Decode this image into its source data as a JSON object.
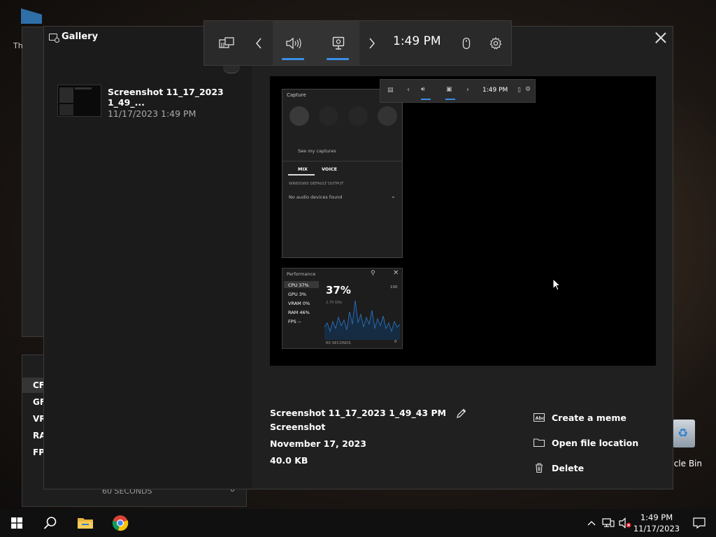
{
  "background": {
    "left_window_fragment": "Th",
    "performance_panel": {
      "labels": [
        "CF",
        "GF",
        "VR",
        "RA",
        "FP"
      ],
      "seconds_label": "60 SECONDS",
      "zero_label": "0"
    },
    "recycle_bin_label": "cycle Bin"
  },
  "game_bar": {
    "time": "1:49 PM",
    "icons": [
      "widget-menu-icon",
      "chevron-left-icon",
      "audio-icon",
      "capture-icon",
      "chevron-right-icon",
      "mouse-icon",
      "gear-icon"
    ],
    "accent_color": "#3a8ee6"
  },
  "gallery": {
    "title": "Gallery",
    "items": [
      {
        "name": "Screenshot 11_17_2023 1_49_...",
        "date": "11/17/2023 1:49 PM"
      }
    ],
    "preview": {
      "capture_title": "Capture",
      "see_my_captures": "See my captures",
      "tab_mix": "MIX",
      "tab_voice": "VOICE",
      "default_output": "WINDOWS DEFAULT OUTPUT",
      "no_devices": "No audio devices found",
      "perf_title": "Performance",
      "perf_stats": [
        "CPU 37%",
        "GPU 3%",
        "VRAM 0%",
        "RAM 46%",
        "FPS --"
      ],
      "perf_big": "37%",
      "perf_ghz": "2.70 GHz",
      "perf_100": "100",
      "perf_seconds": "60 SECONDS",
      "perf_zero": "0",
      "bar_time": "1:49 PM"
    },
    "details": {
      "file_name": "Screenshot 11_17_2023 1_49_43 PM",
      "type": "Screenshot",
      "date": "November 17, 2023",
      "size": "40.0 KB"
    },
    "actions": {
      "meme": "Create a meme",
      "open_location": "Open file location",
      "delete": "Delete"
    }
  },
  "taskbar": {
    "time": "1:49 PM",
    "date": "11/17/2023"
  }
}
